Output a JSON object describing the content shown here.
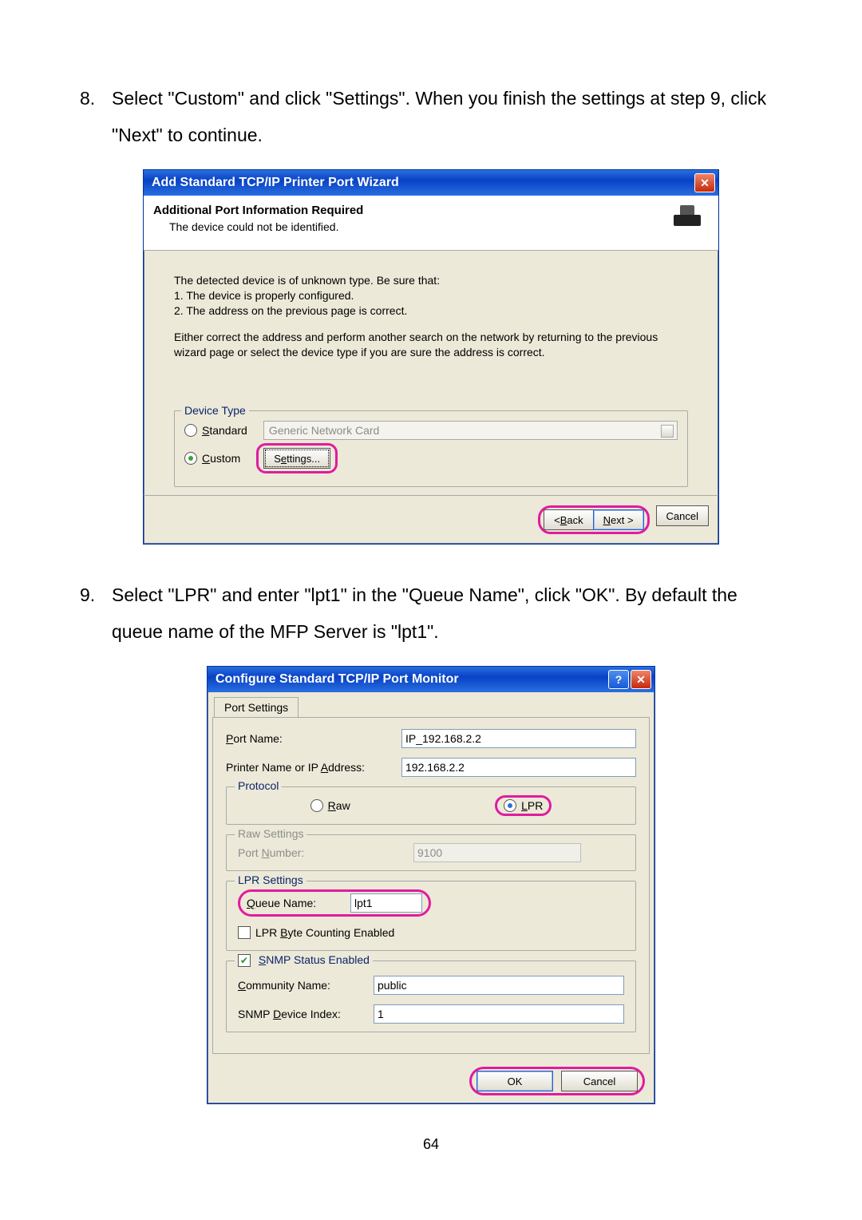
{
  "step8": {
    "num": "8.",
    "text": "Select \"Custom\" and click \"Settings\". When you finish the settings at step 9, click \"Next\" to continue."
  },
  "wiz1": {
    "title": "Add Standard TCP/IP Printer Port Wizard",
    "h1": "Additional Port Information Required",
    "h2": "The device could not be identified.",
    "body1": "The detected device is of unknown type.  Be sure that:",
    "body2": "1.  The device is properly configured.",
    "body3": "2.  The address on the previous page is correct.",
    "body4": "Either correct the address and perform another search on the network by returning to the previous wizard page or select the device type if you are sure the address is correct.",
    "group_legend": "Device Type",
    "standard": "Standard",
    "dropdown_val": "Generic Network Card",
    "custom": "Custom",
    "settings_btn": "Settings...",
    "back": "< Back",
    "next": "Next >",
    "cancel": "Cancel"
  },
  "step9": {
    "num": "9.",
    "text": "Select \"LPR\" and enter \"lpt1\" in the \"Queue Name\", click \"OK\". By default the queue name of the MFP Server is \"lpt1\"."
  },
  "wiz2": {
    "title": "Configure Standard TCP/IP Port Monitor",
    "tab": "Port Settings",
    "port_name_l": "Port Name:",
    "port_name_v": "IP_192.168.2.2",
    "addr_l": "Printer Name or IP Address:",
    "addr_v": "192.168.2.2",
    "protocol": "Protocol",
    "raw": "Raw",
    "lpr": "LPR",
    "raw_settings": "Raw Settings",
    "port_num_l": "Port Number:",
    "port_num_v": "9100",
    "lpr_settings": "LPR Settings",
    "queue_l": "Queue Name:",
    "queue_v": "lpt1",
    "byte_count": "LPR Byte Counting Enabled",
    "snmp_enabled": "SNMP Status Enabled",
    "community_l": "Community Name:",
    "community_v": "public",
    "device_idx_l": "SNMP Device Index:",
    "device_idx_v": "1",
    "ok": "OK",
    "cancel": "Cancel"
  },
  "page_number": "64"
}
